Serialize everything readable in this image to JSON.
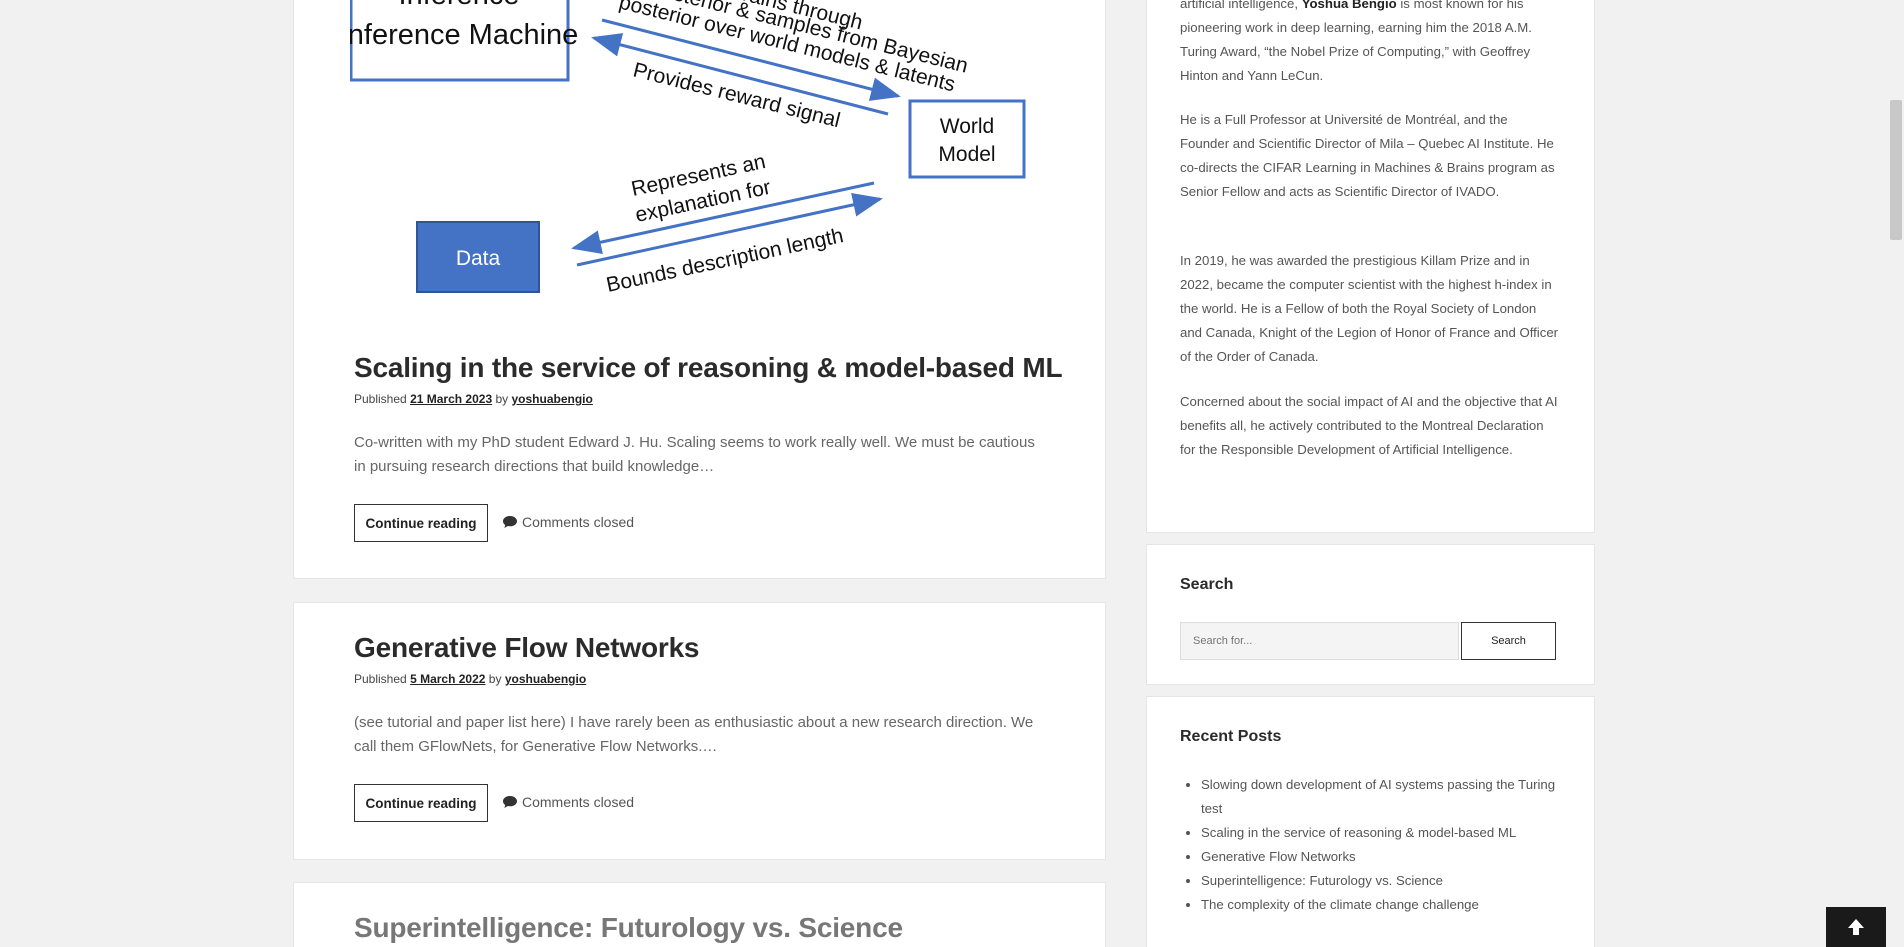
{
  "diagram": {
    "inference_machine": "Inference Machine",
    "world_model": "World Model",
    "data": "Data",
    "arrow_top_label_1": "Trains through",
    "arrow_top_label_2": "posterior & samples from Bayesian",
    "arrow_top_label_3": "posterior over world models & latents",
    "arrow_reward_label": "Provides reward signal",
    "arrow_explain_label_1": "Represents an",
    "arrow_explain_label_2": "explanation for",
    "arrow_bounds_label": "Bounds description length"
  },
  "posts": [
    {
      "title": "Scaling in the service of reasoning & model-based ML",
      "published_label": "Published",
      "date": "21 March 2023",
      "by_label": "by",
      "author": "yoshuabengio",
      "excerpt": "Co-written with my PhD student Edward J. Hu. Scaling seems to work really well. We must be cautious in pursuing research directions that build knowledge…",
      "continue_label": "Continue reading",
      "comments_label": "Comments closed"
    },
    {
      "title": "Generative Flow Networks",
      "published_label": "Published",
      "date": "5 March 2022",
      "by_label": "by",
      "author": "yoshuabengio",
      "excerpt": "(see tutorial and paper list here) I have rarely been as enthusiastic about a new research direction. We call them GFlowNets, for Generative Flow Networks.…",
      "continue_label": "Continue reading",
      "comments_label": "Comments closed"
    },
    {
      "title": "Superintelligence: Futurology vs. Science"
    }
  ],
  "bio": {
    "p1_pre": "artificial intelligence,",
    "p1_name": "Yoshua Bengio",
    "p1_post": "is most known for his pioneering work in deep learning, earning him the 2018 A.M. Turing Award, “the Nobel Prize of Computing,” with Geoffrey Hinton and Yann LeCun.",
    "p2": "He is a Full Professor at Université de Montréal, and the Founder and Scientific Director of Mila – Quebec AI Institute. He co-directs the CIFAR Learning in Machines & Brains program as Senior Fellow and acts as Scientific Director of IVADO.",
    "p3": "In 2019, he was awarded the prestigious Killam Prize and in 2022, became the computer scientist with the highest h-index in the world. He is a Fellow of both the Royal Society of London and Canada, Knight of the Legion of Honor of France and Officer of the Order of Canada.",
    "p4": "Concerned about the social impact of AI and the objective that AI benefits all, he actively contributed to the Montreal Declaration for the Responsible Development of Artificial Intelligence."
  },
  "search": {
    "title": "Search",
    "placeholder": "Search for...",
    "button_label": "Search"
  },
  "recent_posts": {
    "title": "Recent Posts",
    "items": [
      "Slowing down development of AI systems passing the Turing test",
      "Scaling in the service of reasoning & model-based ML",
      "Generative Flow Networks",
      "Superintelligence: Futurology vs. Science",
      "The complexity of the climate change challenge"
    ]
  },
  "colors": {
    "diagram_blue": "#4472c4",
    "page_bg": "#f1f1f1"
  },
  "icons": {
    "comment": "speech-bubble-icon",
    "back_to_top": "arrow-up-icon"
  }
}
